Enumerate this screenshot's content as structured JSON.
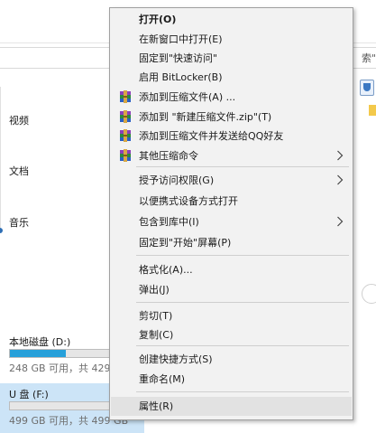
{
  "explorer": {
    "search_fragment": "索\"",
    "left_items": [
      "视频",
      "文档",
      "音乐"
    ],
    "drives": [
      {
        "name": "本地磁盘 (D:)",
        "info": "248 GB 可用，共 429",
        "used_fraction": 0.42,
        "selected": false
      },
      {
        "name": "U 盘 (F:)",
        "info": "499 GB 可用，共 499 GB",
        "used_fraction": 0.0,
        "selected": true
      }
    ]
  },
  "context_menu": {
    "items": [
      {
        "label": "打开(O)",
        "bold": true
      },
      {
        "label": "在新窗口中打开(E)"
      },
      {
        "label": "固定到\"快速访问\""
      },
      {
        "label": "启用 BitLocker(B)"
      },
      {
        "label": "添加到压缩文件(A) ...",
        "icon": "winrar-icon"
      },
      {
        "label": "添加到 \"新建压缩文件.zip\"(T)",
        "icon": "winrar-icon"
      },
      {
        "label": "添加到压缩文件并发送给QQ好友",
        "icon": "winrar-icon"
      },
      {
        "label": "其他压缩命令",
        "icon": "winrar-icon",
        "submenu": true
      },
      {
        "label": "授予访问权限(G)",
        "submenu": true
      },
      {
        "label": "以便携式设备方式打开"
      },
      {
        "label": "包含到库中(I)",
        "submenu": true
      },
      {
        "label": "固定到\"开始\"屏幕(P)"
      },
      {
        "label": "格式化(A)..."
      },
      {
        "label": "弹出(J)"
      },
      {
        "label": "剪切(T)"
      },
      {
        "label": "复制(C)"
      },
      {
        "label": "创建快捷方式(S)"
      },
      {
        "label": "重命名(M)"
      },
      {
        "label": "属性(R)",
        "highlighted": true
      }
    ]
  }
}
